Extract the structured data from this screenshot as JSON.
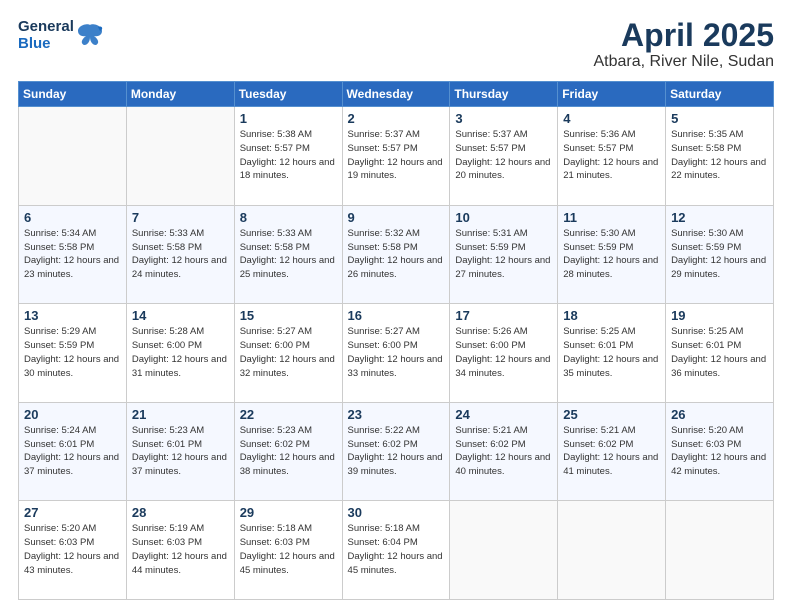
{
  "header": {
    "logo_general": "General",
    "logo_blue": "Blue",
    "title": "April 2025",
    "subtitle": "Atbara, River Nile, Sudan"
  },
  "days_of_week": [
    "Sunday",
    "Monday",
    "Tuesday",
    "Wednesday",
    "Thursday",
    "Friday",
    "Saturday"
  ],
  "weeks": [
    [
      {
        "day": "",
        "sunrise": "",
        "sunset": "",
        "daylight": ""
      },
      {
        "day": "",
        "sunrise": "",
        "sunset": "",
        "daylight": ""
      },
      {
        "day": "1",
        "sunrise": "Sunrise: 5:38 AM",
        "sunset": "Sunset: 5:57 PM",
        "daylight": "Daylight: 12 hours and 18 minutes."
      },
      {
        "day": "2",
        "sunrise": "Sunrise: 5:37 AM",
        "sunset": "Sunset: 5:57 PM",
        "daylight": "Daylight: 12 hours and 19 minutes."
      },
      {
        "day": "3",
        "sunrise": "Sunrise: 5:37 AM",
        "sunset": "Sunset: 5:57 PM",
        "daylight": "Daylight: 12 hours and 20 minutes."
      },
      {
        "day": "4",
        "sunrise": "Sunrise: 5:36 AM",
        "sunset": "Sunset: 5:57 PM",
        "daylight": "Daylight: 12 hours and 21 minutes."
      },
      {
        "day": "5",
        "sunrise": "Sunrise: 5:35 AM",
        "sunset": "Sunset: 5:58 PM",
        "daylight": "Daylight: 12 hours and 22 minutes."
      }
    ],
    [
      {
        "day": "6",
        "sunrise": "Sunrise: 5:34 AM",
        "sunset": "Sunset: 5:58 PM",
        "daylight": "Daylight: 12 hours and 23 minutes."
      },
      {
        "day": "7",
        "sunrise": "Sunrise: 5:33 AM",
        "sunset": "Sunset: 5:58 PM",
        "daylight": "Daylight: 12 hours and 24 minutes."
      },
      {
        "day": "8",
        "sunrise": "Sunrise: 5:33 AM",
        "sunset": "Sunset: 5:58 PM",
        "daylight": "Daylight: 12 hours and 25 minutes."
      },
      {
        "day": "9",
        "sunrise": "Sunrise: 5:32 AM",
        "sunset": "Sunset: 5:58 PM",
        "daylight": "Daylight: 12 hours and 26 minutes."
      },
      {
        "day": "10",
        "sunrise": "Sunrise: 5:31 AM",
        "sunset": "Sunset: 5:59 PM",
        "daylight": "Daylight: 12 hours and 27 minutes."
      },
      {
        "day": "11",
        "sunrise": "Sunrise: 5:30 AM",
        "sunset": "Sunset: 5:59 PM",
        "daylight": "Daylight: 12 hours and 28 minutes."
      },
      {
        "day": "12",
        "sunrise": "Sunrise: 5:30 AM",
        "sunset": "Sunset: 5:59 PM",
        "daylight": "Daylight: 12 hours and 29 minutes."
      }
    ],
    [
      {
        "day": "13",
        "sunrise": "Sunrise: 5:29 AM",
        "sunset": "Sunset: 5:59 PM",
        "daylight": "Daylight: 12 hours and 30 minutes."
      },
      {
        "day": "14",
        "sunrise": "Sunrise: 5:28 AM",
        "sunset": "Sunset: 6:00 PM",
        "daylight": "Daylight: 12 hours and 31 minutes."
      },
      {
        "day": "15",
        "sunrise": "Sunrise: 5:27 AM",
        "sunset": "Sunset: 6:00 PM",
        "daylight": "Daylight: 12 hours and 32 minutes."
      },
      {
        "day": "16",
        "sunrise": "Sunrise: 5:27 AM",
        "sunset": "Sunset: 6:00 PM",
        "daylight": "Daylight: 12 hours and 33 minutes."
      },
      {
        "day": "17",
        "sunrise": "Sunrise: 5:26 AM",
        "sunset": "Sunset: 6:00 PM",
        "daylight": "Daylight: 12 hours and 34 minutes."
      },
      {
        "day": "18",
        "sunrise": "Sunrise: 5:25 AM",
        "sunset": "Sunset: 6:01 PM",
        "daylight": "Daylight: 12 hours and 35 minutes."
      },
      {
        "day": "19",
        "sunrise": "Sunrise: 5:25 AM",
        "sunset": "Sunset: 6:01 PM",
        "daylight": "Daylight: 12 hours and 36 minutes."
      }
    ],
    [
      {
        "day": "20",
        "sunrise": "Sunrise: 5:24 AM",
        "sunset": "Sunset: 6:01 PM",
        "daylight": "Daylight: 12 hours and 37 minutes."
      },
      {
        "day": "21",
        "sunrise": "Sunrise: 5:23 AM",
        "sunset": "Sunset: 6:01 PM",
        "daylight": "Daylight: 12 hours and 37 minutes."
      },
      {
        "day": "22",
        "sunrise": "Sunrise: 5:23 AM",
        "sunset": "Sunset: 6:02 PM",
        "daylight": "Daylight: 12 hours and 38 minutes."
      },
      {
        "day": "23",
        "sunrise": "Sunrise: 5:22 AM",
        "sunset": "Sunset: 6:02 PM",
        "daylight": "Daylight: 12 hours and 39 minutes."
      },
      {
        "day": "24",
        "sunrise": "Sunrise: 5:21 AM",
        "sunset": "Sunset: 6:02 PM",
        "daylight": "Daylight: 12 hours and 40 minutes."
      },
      {
        "day": "25",
        "sunrise": "Sunrise: 5:21 AM",
        "sunset": "Sunset: 6:02 PM",
        "daylight": "Daylight: 12 hours and 41 minutes."
      },
      {
        "day": "26",
        "sunrise": "Sunrise: 5:20 AM",
        "sunset": "Sunset: 6:03 PM",
        "daylight": "Daylight: 12 hours and 42 minutes."
      }
    ],
    [
      {
        "day": "27",
        "sunrise": "Sunrise: 5:20 AM",
        "sunset": "Sunset: 6:03 PM",
        "daylight": "Daylight: 12 hours and 43 minutes."
      },
      {
        "day": "28",
        "sunrise": "Sunrise: 5:19 AM",
        "sunset": "Sunset: 6:03 PM",
        "daylight": "Daylight: 12 hours and 44 minutes."
      },
      {
        "day": "29",
        "sunrise": "Sunrise: 5:18 AM",
        "sunset": "Sunset: 6:03 PM",
        "daylight": "Daylight: 12 hours and 45 minutes."
      },
      {
        "day": "30",
        "sunrise": "Sunrise: 5:18 AM",
        "sunset": "Sunset: 6:04 PM",
        "daylight": "Daylight: 12 hours and 45 minutes."
      },
      {
        "day": "",
        "sunrise": "",
        "sunset": "",
        "daylight": ""
      },
      {
        "day": "",
        "sunrise": "",
        "sunset": "",
        "daylight": ""
      },
      {
        "day": "",
        "sunrise": "",
        "sunset": "",
        "daylight": ""
      }
    ]
  ]
}
